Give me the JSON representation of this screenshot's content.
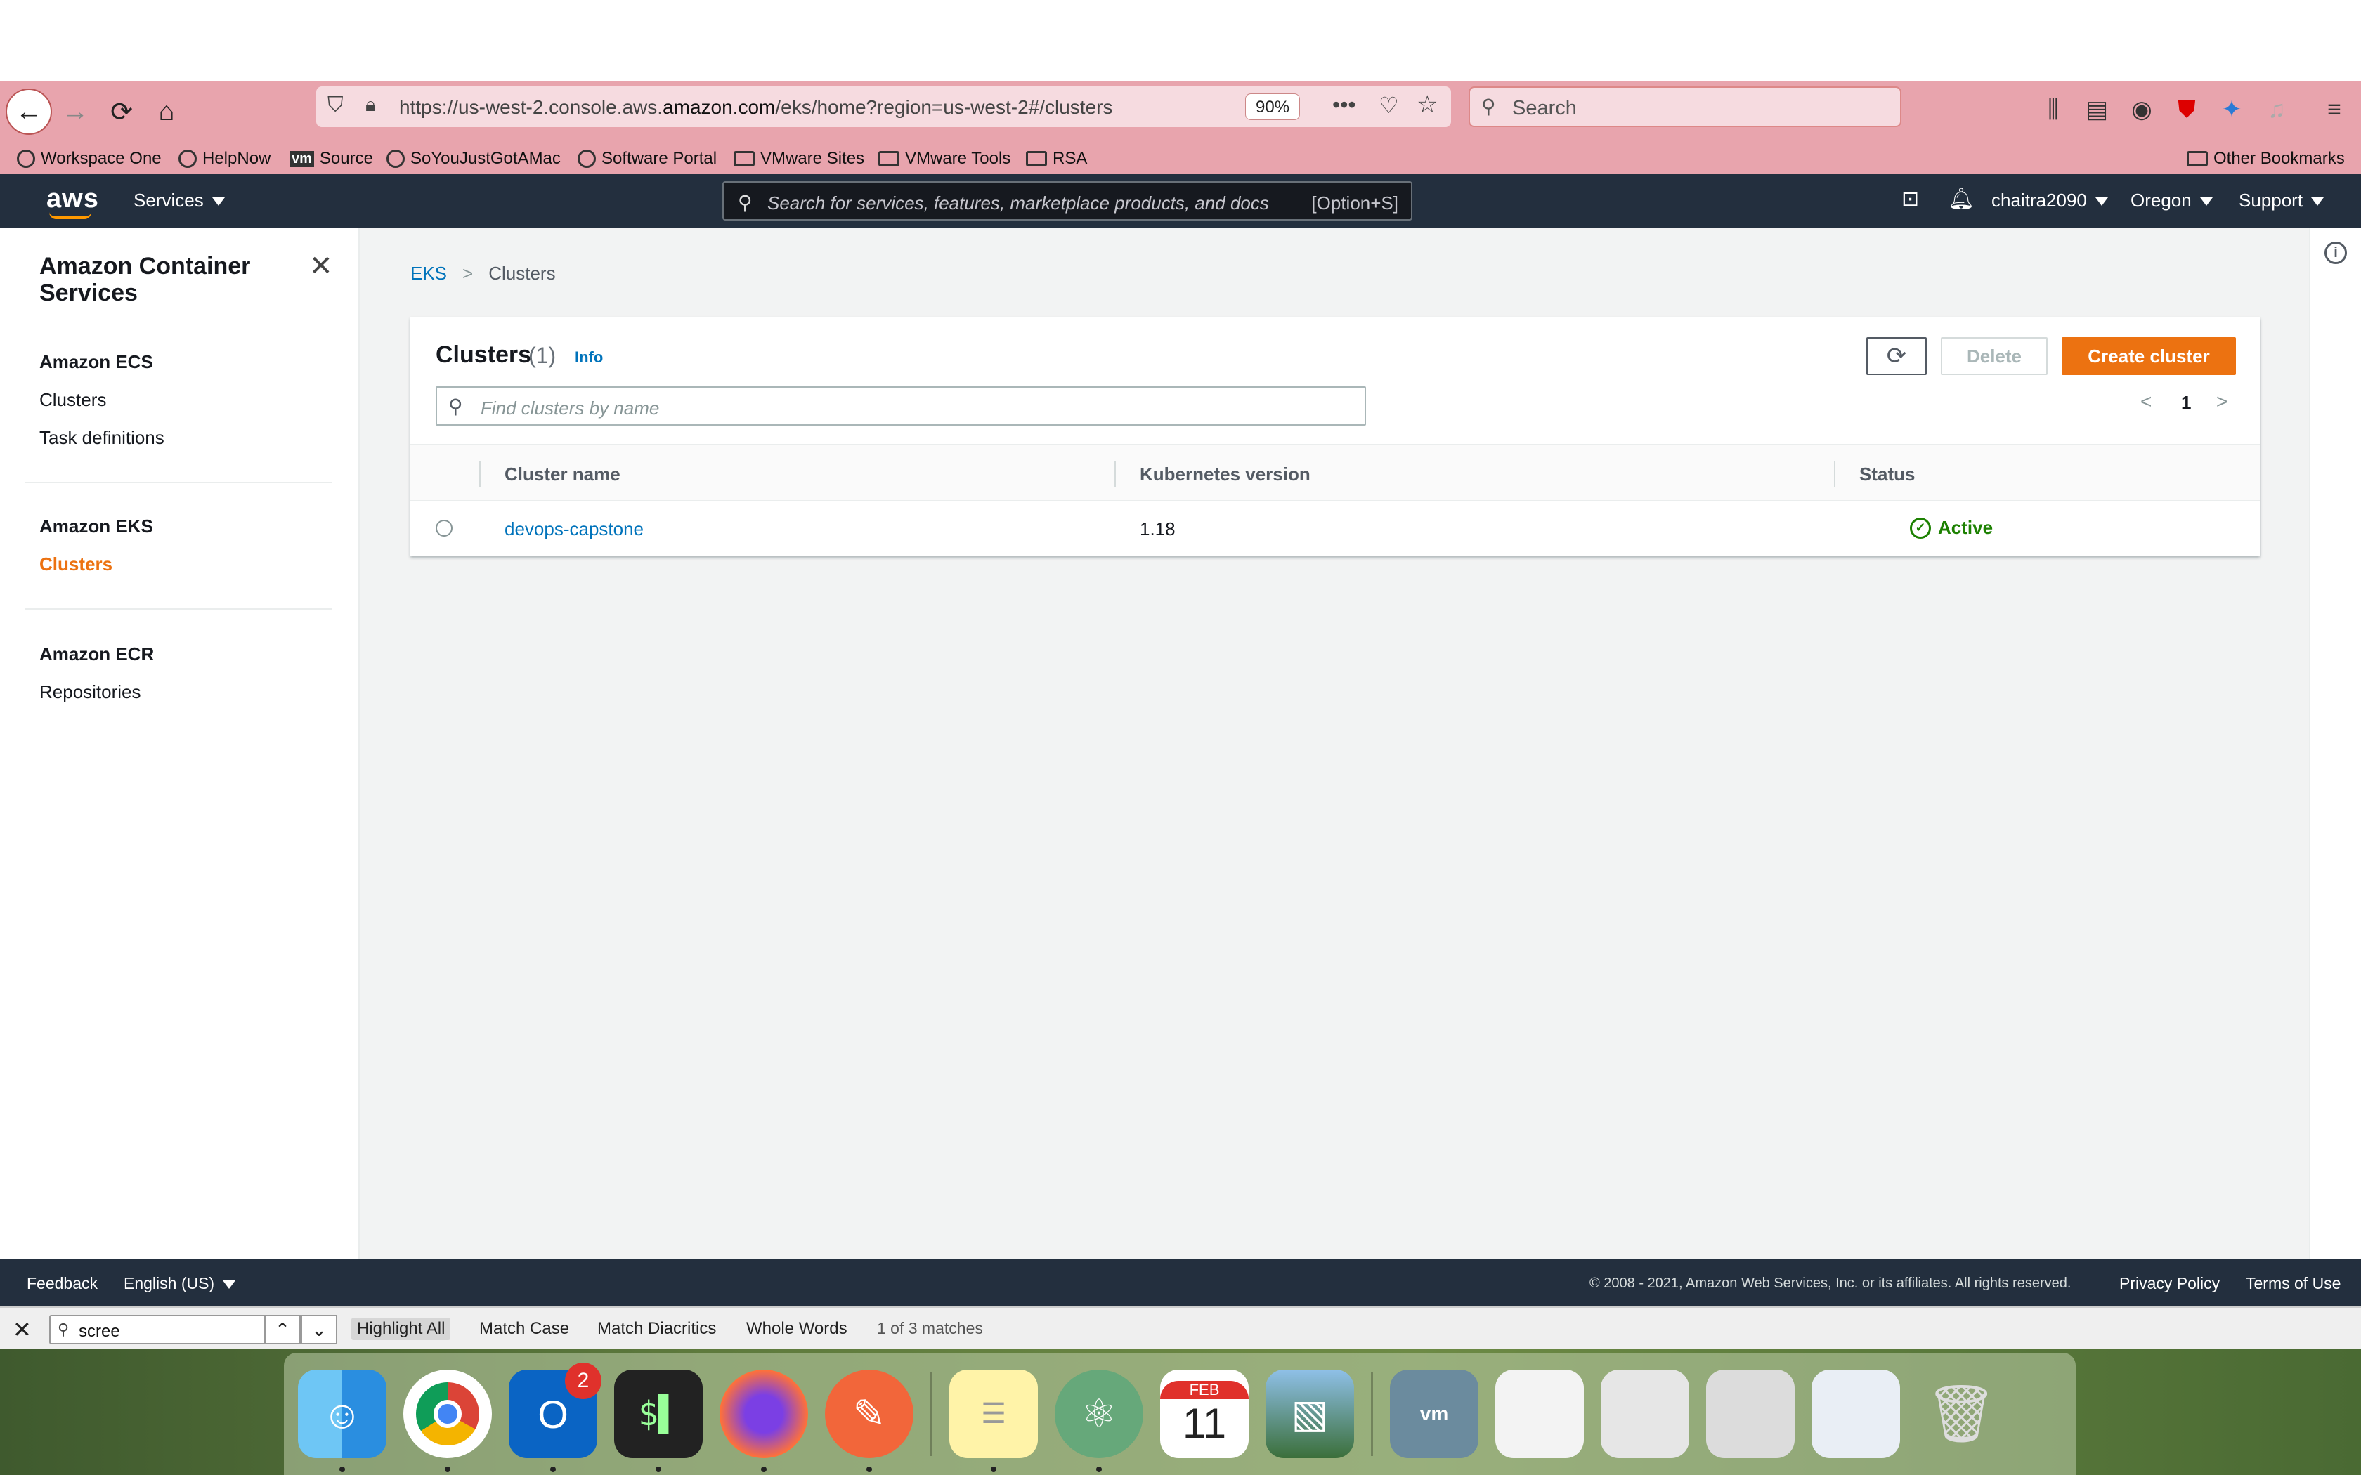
{
  "browser": {
    "url_prefix": "https://us-west-2.console.aws.",
    "url_host": "amazon.com",
    "url_suffix": "/eks/home?region=us-west-2#/clusters",
    "zoom": "90%",
    "search_placeholder": "Search"
  },
  "bookmarks": [
    {
      "label": "Workspace One",
      "icon": "globe-icon"
    },
    {
      "label": "HelpNow",
      "icon": "globe-icon"
    },
    {
      "label": "Source",
      "icon": "vm-icon"
    },
    {
      "label": "SoYouJustGotAMac",
      "icon": "globe-icon"
    },
    {
      "label": "Software Portal",
      "icon": "globe-icon"
    },
    {
      "label": "VMware Sites",
      "icon": "folder-icon"
    },
    {
      "label": "VMware Tools",
      "icon": "folder-icon"
    },
    {
      "label": "RSA",
      "icon": "folder-icon"
    }
  ],
  "other_bookmarks": "Other Bookmarks",
  "aws_header": {
    "logo": "aws",
    "services": "Services",
    "search_placeholder": "Search for services, features, marketplace products, and docs",
    "search_shortcut": "[Option+S]",
    "user": "chaitra2090",
    "region": "Oregon",
    "support": "Support"
  },
  "sidebar": {
    "title": "Amazon Container Services",
    "groups": [
      {
        "title": "Amazon ECS",
        "items": [
          "Clusters",
          "Task definitions"
        ]
      },
      {
        "title": "Amazon EKS",
        "items": [
          "Clusters"
        ]
      },
      {
        "title": "Amazon ECR",
        "items": [
          "Repositories"
        ]
      }
    ]
  },
  "breadcrumb": {
    "root": "EKS",
    "current": "Clusters"
  },
  "panel": {
    "title": "Clusters",
    "count": "(1)",
    "info": "Info",
    "delete_label": "Delete",
    "create_label": "Create cluster",
    "filter_placeholder": "Find clusters by name",
    "page": "1",
    "columns": [
      "Cluster name",
      "Kubernetes version",
      "Status"
    ],
    "rows": [
      {
        "name": "devops-capstone",
        "version": "1.18",
        "status": "Active"
      }
    ]
  },
  "footer": {
    "feedback": "Feedback",
    "language": "English (US)",
    "copyright": "© 2008 - 2021, Amazon Web Services, Inc. or its affiliates. All rights reserved.",
    "privacy": "Privacy Policy",
    "terms": "Terms of Use"
  },
  "findbar": {
    "query": "scree",
    "options": [
      "Highlight All",
      "Match Case",
      "Match Diacritics",
      "Whole Words"
    ],
    "status": "1 of 3 matches"
  },
  "dock": {
    "outlook_badge": "2",
    "calendar_month": "FEB",
    "calendar_day": "11"
  },
  "colors": {
    "accent": "#ec7211",
    "link": "#0073bb",
    "header": "#232f3e",
    "status_active": "#1d8102",
    "browser_chrome": "#e8a4ad"
  }
}
